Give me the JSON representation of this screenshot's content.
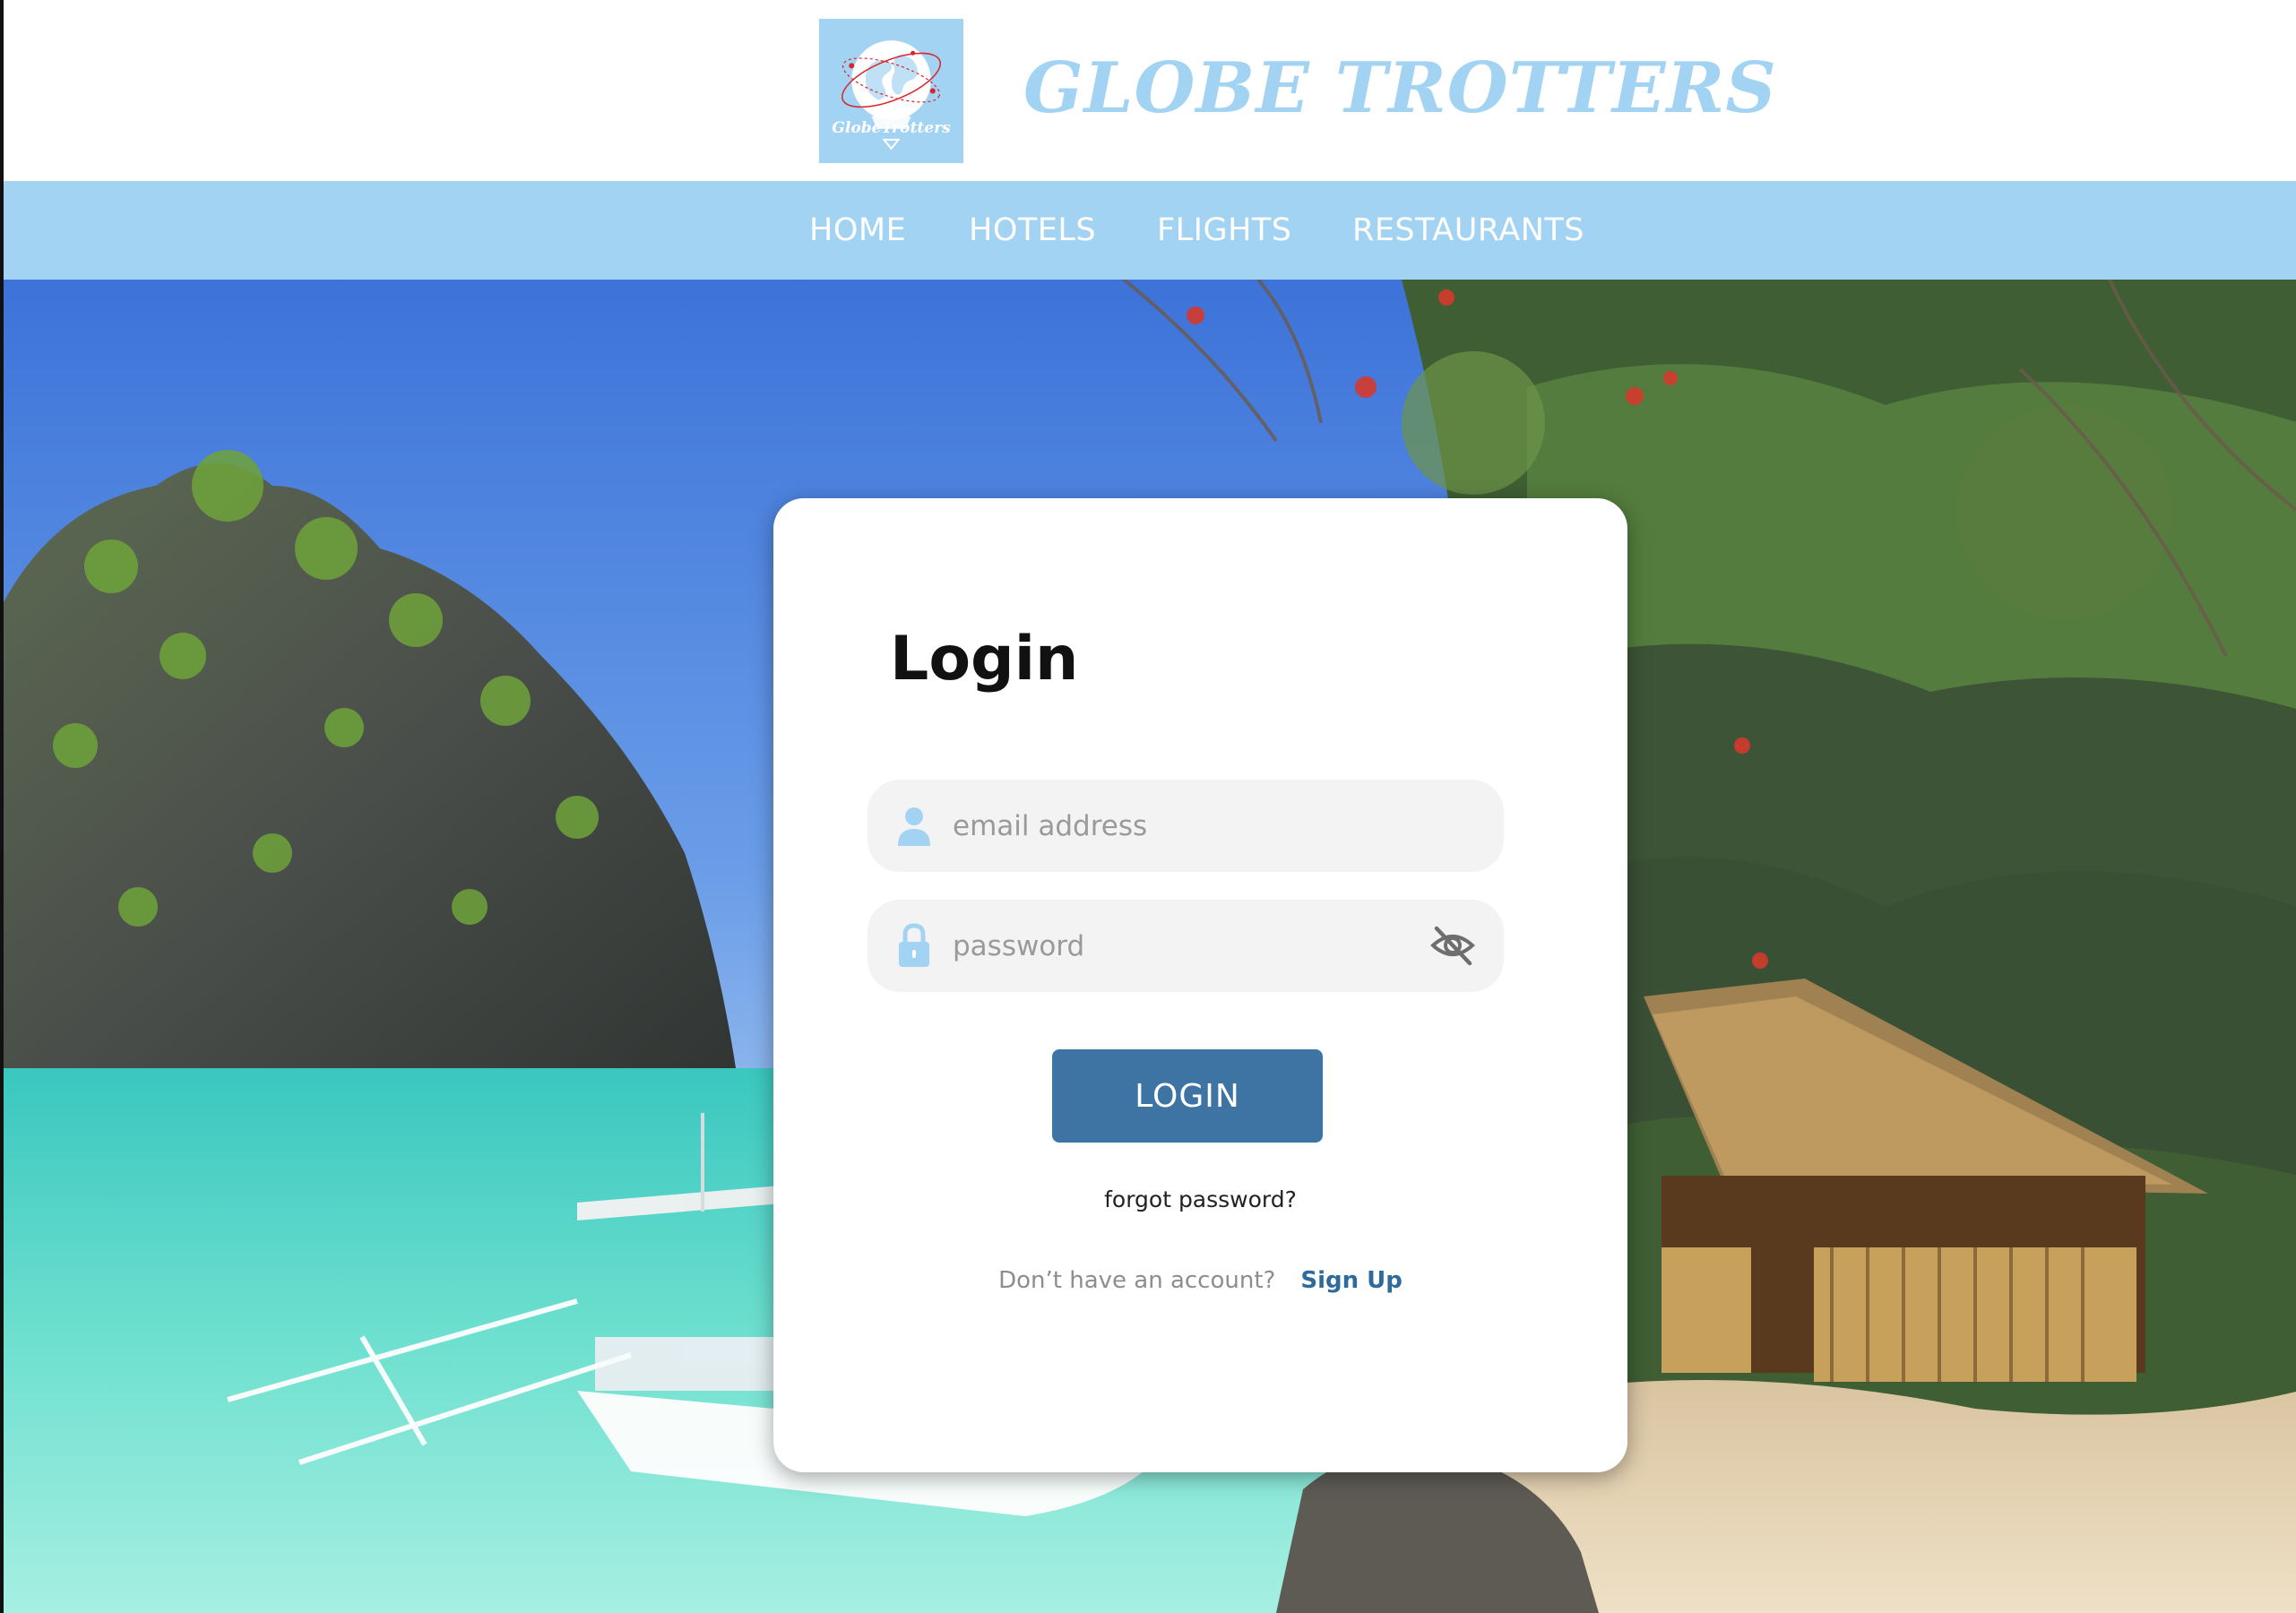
{
  "brand": {
    "title": "GLOBE TROTTERS",
    "logo_text": "GlobeTrotters"
  },
  "nav": {
    "items": [
      {
        "label": "HOME"
      },
      {
        "label": "HOTELS"
      },
      {
        "label": "FLIGHTS"
      },
      {
        "label": "RESTAURANTS"
      }
    ]
  },
  "login": {
    "title": "Login",
    "email": {
      "placeholder": "email address",
      "value": "",
      "icon": "user-icon"
    },
    "password": {
      "placeholder": "password",
      "value": "",
      "icon": "lock-icon",
      "toggle_icon": "eye-slash-icon"
    },
    "submit_label": "LOGIN",
    "forgot_label": "forgot password?",
    "signup_prompt": "Don’t have an account?",
    "signup_label": "Sign Up"
  },
  "colors": {
    "brand": "#a3d3f3",
    "button": "#3d74a4",
    "link": "#2f6a9c"
  }
}
